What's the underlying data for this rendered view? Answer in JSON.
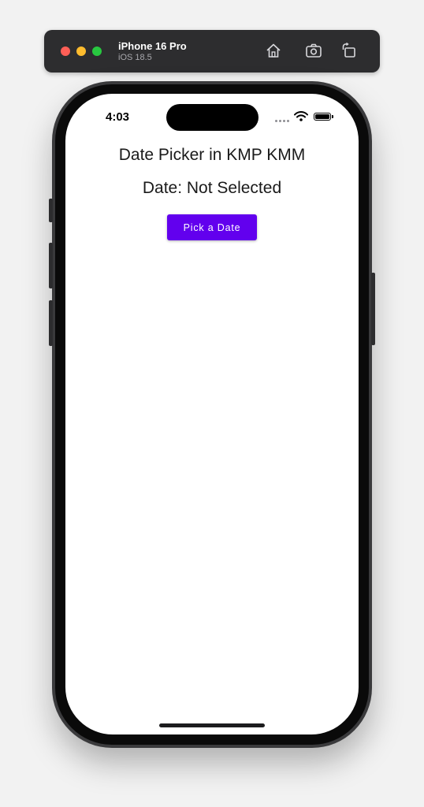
{
  "simulator": {
    "device_name": "iPhone 16 Pro",
    "os_version": "iOS 18.5",
    "toolbar_icons": [
      "home-icon",
      "screenshot-icon",
      "rotate-icon"
    ]
  },
  "status_bar": {
    "time": "4:03"
  },
  "app": {
    "title": "Date Picker in KMP KMM",
    "date_label": "Date: Not Selected",
    "pick_button_label": "Pick a Date",
    "accent_color": "#6200ee"
  }
}
